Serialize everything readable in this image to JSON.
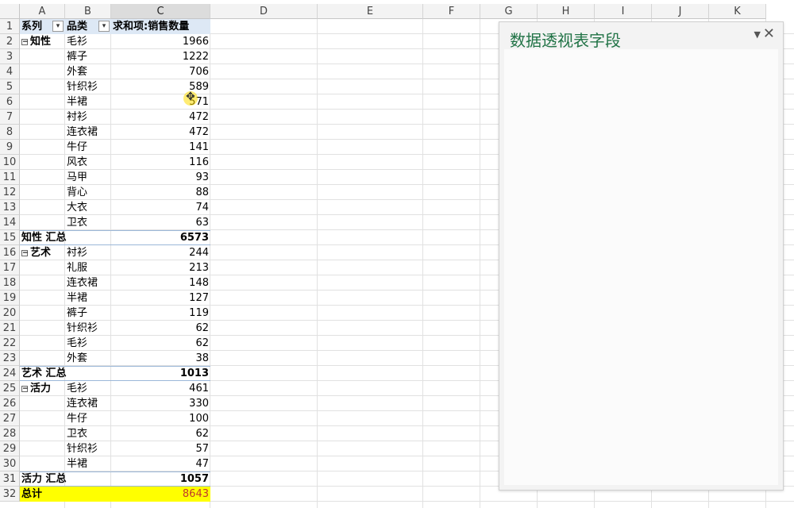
{
  "columns": [
    "A",
    "B",
    "C",
    "D",
    "E",
    "F",
    "G",
    "H",
    "I",
    "J",
    "K"
  ],
  "rows": [
    "1",
    "2",
    "3",
    "4",
    "5",
    "6",
    "7",
    "8",
    "9",
    "10",
    "11",
    "12",
    "13",
    "14",
    "15",
    "16",
    "17",
    "18",
    "19",
    "20",
    "21",
    "22",
    "23",
    "24",
    "25",
    "26",
    "27",
    "28",
    "29",
    "30",
    "31",
    "32"
  ],
  "pivot": {
    "header_series": "系列",
    "header_category": "品类",
    "header_value": "求和项:销售数量",
    "filter_icon": "filter-dropdown-icon",
    "collapse_glyph": "⊟",
    "groups": [
      {
        "name": "知性",
        "items": [
          {
            "cat": "毛衫",
            "val": "1966"
          },
          {
            "cat": "裤子",
            "val": "1222"
          },
          {
            "cat": "外套",
            "val": "706"
          },
          {
            "cat": "针织衫",
            "val": "589"
          },
          {
            "cat": "半裙",
            "val": "571"
          },
          {
            "cat": "衬衫",
            "val": "472"
          },
          {
            "cat": "连衣裙",
            "val": "472"
          },
          {
            "cat": "牛仔",
            "val": "141"
          },
          {
            "cat": "风衣",
            "val": "116"
          },
          {
            "cat": "马甲",
            "val": "93"
          },
          {
            "cat": "背心",
            "val": "88"
          },
          {
            "cat": "大衣",
            "val": "74"
          },
          {
            "cat": "卫衣",
            "val": "63"
          }
        ],
        "subtotal_label": "知性 汇总",
        "subtotal_val": "6573"
      },
      {
        "name": "艺术",
        "items": [
          {
            "cat": "衬衫",
            "val": "244"
          },
          {
            "cat": "礼服",
            "val": "213"
          },
          {
            "cat": "连衣裙",
            "val": "148"
          },
          {
            "cat": "半裙",
            "val": "127"
          },
          {
            "cat": "裤子",
            "val": "119"
          },
          {
            "cat": "针织衫",
            "val": "62"
          },
          {
            "cat": "毛衫",
            "val": "62"
          },
          {
            "cat": "外套",
            "val": "38"
          }
        ],
        "subtotal_label": "艺术 汇总",
        "subtotal_val": "1013"
      },
      {
        "name": "活力",
        "items": [
          {
            "cat": "毛衫",
            "val": "461"
          },
          {
            "cat": "连衣裙",
            "val": "330"
          },
          {
            "cat": "牛仔",
            "val": "100"
          },
          {
            "cat": "卫衣",
            "val": "62"
          },
          {
            "cat": "针织衫",
            "val": "57"
          },
          {
            "cat": "半裙",
            "val": "47"
          }
        ],
        "subtotal_label": "活力 汇总",
        "subtotal_val": "1057"
      }
    ],
    "grand_label": "总计",
    "grand_val": "8643"
  },
  "panel": {
    "title": "数据透视表字段",
    "dropdown_glyph": "▼",
    "close_glyph": "✕"
  },
  "colors": {
    "accent": "#217346",
    "header_fill": "#dde8f5",
    "grand_fill": "#ffff00",
    "grand_text": "#c0392b"
  }
}
